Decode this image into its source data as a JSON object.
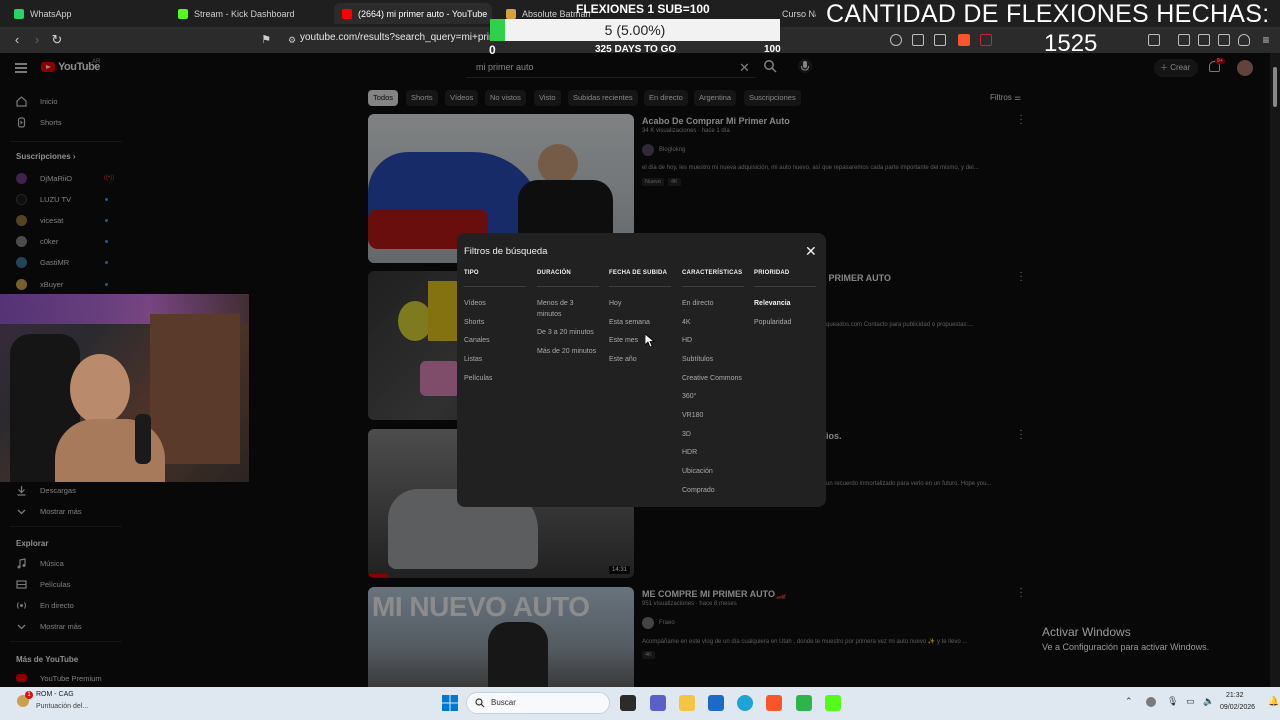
{
  "browser": {
    "tabs": [
      {
        "label": "WhatsApp",
        "color": "#25d366"
      },
      {
        "label": "Stream - Kick Dashboard",
        "color": "#53fc18"
      },
      {
        "label": "(2664) mi primer auto - YouTube",
        "color": "#ff0000",
        "active": true
      },
      {
        "label": "Absolute Batman",
        "color": "#d6a040"
      },
      {
        "label": "Curso Nacional de Seguridad Vial",
        "color": "#4a8cf0"
      }
    ],
    "url": "youtube.com/results?search_query=mi+primer+auto"
  },
  "overlay": {
    "goal_title": "FLEXIONES 1 SUB=100",
    "progress_text": "5 (5.00%)",
    "progress_fraction": 0.05,
    "goal_min": "0",
    "goal_days": "325 DAYS TO GO",
    "goal_max": "100",
    "count_title": "CANTIDAD DE FLEXIONES HECHAS:",
    "count_value": "1525"
  },
  "header": {
    "logo": "YouTube",
    "logo_cc": "AR",
    "search_value": "mi primer auto",
    "create_label": "Crear",
    "bell_badge": "9+"
  },
  "sidebar": {
    "items_top": [
      {
        "label": "Inicio",
        "icon": "home-icon"
      },
      {
        "label": "Shorts",
        "icon": "shorts-icon"
      }
    ],
    "subs_heading": "Suscripciones",
    "subs": [
      {
        "label": "DjMaRiiO",
        "color": "#7a3b8c"
      },
      {
        "label": "LUZU TV",
        "color": "#1a1a1a"
      },
      {
        "label": "vicesat",
        "color": "#9c7a3e"
      },
      {
        "label": "c0ker",
        "color": "#8a8a8a"
      },
      {
        "label": "GastiMR",
        "color": "#3f7fa5"
      },
      {
        "label": "xBuyer",
        "color": "#d4b04a"
      }
    ],
    "items_mid": [
      {
        "label": "Descargas",
        "icon": "download-icon"
      },
      {
        "label": "Mostrar más",
        "icon": "chevron-down-icon"
      }
    ],
    "explore_heading": "Explorar",
    "explore": [
      {
        "label": "Música",
        "icon": "music-icon"
      },
      {
        "label": "Películas",
        "icon": "film-icon"
      },
      {
        "label": "En directo",
        "icon": "live-icon"
      },
      {
        "label": "Mostrar más",
        "icon": "chevron-down-icon"
      }
    ],
    "more_heading": "Más de YouTube",
    "more": [
      {
        "label": "YouTube Premium",
        "icon": "youtube-premium-icon"
      }
    ]
  },
  "chips": [
    "Todos",
    "Shorts",
    "Vídeos",
    "No vistos",
    "Visto",
    "Subidas recientes",
    "En directo",
    "Argentina",
    "Suscripciones"
  ],
  "filters_label": "Filtros",
  "results": [
    {
      "title": "Acabo De Comprar Mi Primer Auto",
      "meta": "34 K visualizaciones · hace 1 día",
      "channel": "Bloglokng",
      "desc": "el día de hoy, les muestro mi nueva adquisición, mi auto nuevo, así que repasaremos cada parte importante del mismo, y del...",
      "badges": [
        "Nuevo",
        "4K"
      ],
      "duration": ""
    },
    {
      "title": "TU PRIMER AUTO",
      "meta": "",
      "channel": "",
      "desc": "queados.com Contacto para publicidad o propuestas:...",
      "badges": [],
      "duration": ""
    },
    {
      "title": "ios.",
      "meta": "",
      "channel": "",
      "desc": "un recuerdo inmortalizado para verlo en un futuro. Hope you...",
      "badges": [],
      "duration": "14:31"
    },
    {
      "title": "ME COMPRE MI PRIMER AUTO🏎️",
      "meta": "951 visualizaciones · hace 8 meses",
      "channel": "Fraeo",
      "desc": "Acompáñame en este vlog de un día cualquiera en Utah , donde te muestro por primera vez mi auto nuevo ✨ y te llevo ...",
      "badges": [
        "4K"
      ],
      "duration": ""
    }
  ],
  "thumb4_text": "MI NUEVO AUTO",
  "modal": {
    "title": "Filtros de búsqueda",
    "columns": [
      {
        "heading": "TIPO",
        "options": [
          "Vídeos",
          "Shorts",
          "Canales",
          "Listas",
          "Películas"
        ]
      },
      {
        "heading": "DURACIÓN",
        "options": [
          "Menos de 3 minutos",
          "De 3 a 20 minutos",
          "Más de 20 minutos"
        ]
      },
      {
        "heading": "FECHA DE SUBIDA",
        "options": [
          "Hoy",
          "Esta semana",
          "Este mes",
          "Este año"
        ]
      },
      {
        "heading": "CARACTERÍSTICAS",
        "options": [
          "En directo",
          "4K",
          "HD",
          "Subtítulos",
          "Creative Commons",
          "360°",
          "VR180",
          "3D",
          "HDR",
          "Ubicación",
          "Comprado"
        ]
      },
      {
        "heading": "PRIORIDAD",
        "options": [
          "Relevancia",
          "Popularidad"
        ],
        "active": "Relevancia"
      }
    ]
  },
  "activate_windows": {
    "line1": "Activar Windows",
    "line2": "Ve a Configuración para activar Windows."
  },
  "taskbar": {
    "notif_title": "ROM - CAG",
    "notif_sub": "Puntuación del...",
    "notif_badge": "1",
    "search_placeholder": "Buscar",
    "time": "21:32",
    "date": "09/02/2026"
  }
}
